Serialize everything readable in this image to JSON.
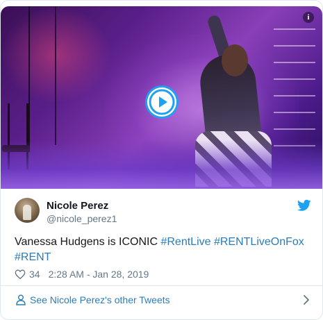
{
  "media": {
    "play_icon": "play-circle-icon",
    "info_icon": "info-icon",
    "info_glyph": "i"
  },
  "author": {
    "name": "Nicole Perez",
    "handle": "@nicole_perez1",
    "avatar_icon": "avatar"
  },
  "tweet": {
    "text_plain": "Vanessa Hudgens is ICONIC ",
    "hashtags": [
      "#RentLive",
      "#RENTLiveOnFox",
      "#RENT"
    ]
  },
  "meta": {
    "likes": "34",
    "timestamp": "2:28 AM - Jan 28, 2019"
  },
  "footer": {
    "link_text": "See Nicole Perez's other Tweets"
  },
  "colors": {
    "accent": "#1da1f2",
    "link": "#2b7bb9",
    "muted": "#657786"
  }
}
